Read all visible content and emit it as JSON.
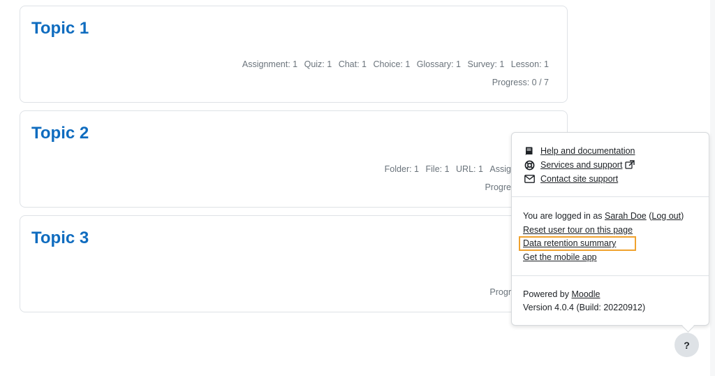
{
  "topics": [
    {
      "title": "Topic 1",
      "activities": [
        "Assignment: 1",
        "Quiz: 1",
        "Chat: 1",
        "Choice: 1",
        "Glossary: 1",
        "Survey: 1",
        "Lesson: 1"
      ],
      "progress": "Progress: 0 / 7"
    },
    {
      "title": "Topic 2",
      "activities": [
        "Folder: 1",
        "File: 1",
        "URL: 1",
        "Assig"
      ],
      "progress": "Progre"
    },
    {
      "title": "Topic 3",
      "activities": [],
      "progress": "Progr"
    }
  ],
  "footer": {
    "help_docs": "Help and documentation",
    "services_support": "Services and support",
    "contact_support": "Contact site support",
    "logged_in_prefix": "You are logged in as ",
    "user_name": "Sarah Doe",
    "logout_open": " (",
    "logout": "Log out",
    "logout_close": ")",
    "reset_tour": "Reset user tour on this page",
    "data_retention": "Data retention summary",
    "mobile_app": "Get the mobile app",
    "powered_by_prefix": "Powered by ",
    "moodle": "Moodle",
    "version": "Version 4.0.4 (Build: 20220912)"
  },
  "help_button": {
    "label": "?"
  },
  "colors": {
    "topic_title": "#0f6cbf",
    "highlight": "#f0a22e",
    "muted_text": "#6a737b"
  },
  "icons": {
    "help_docs": "book-icon",
    "services_support": "life-ring-icon",
    "contact_support": "envelope-icon",
    "external": "external-link-icon"
  }
}
